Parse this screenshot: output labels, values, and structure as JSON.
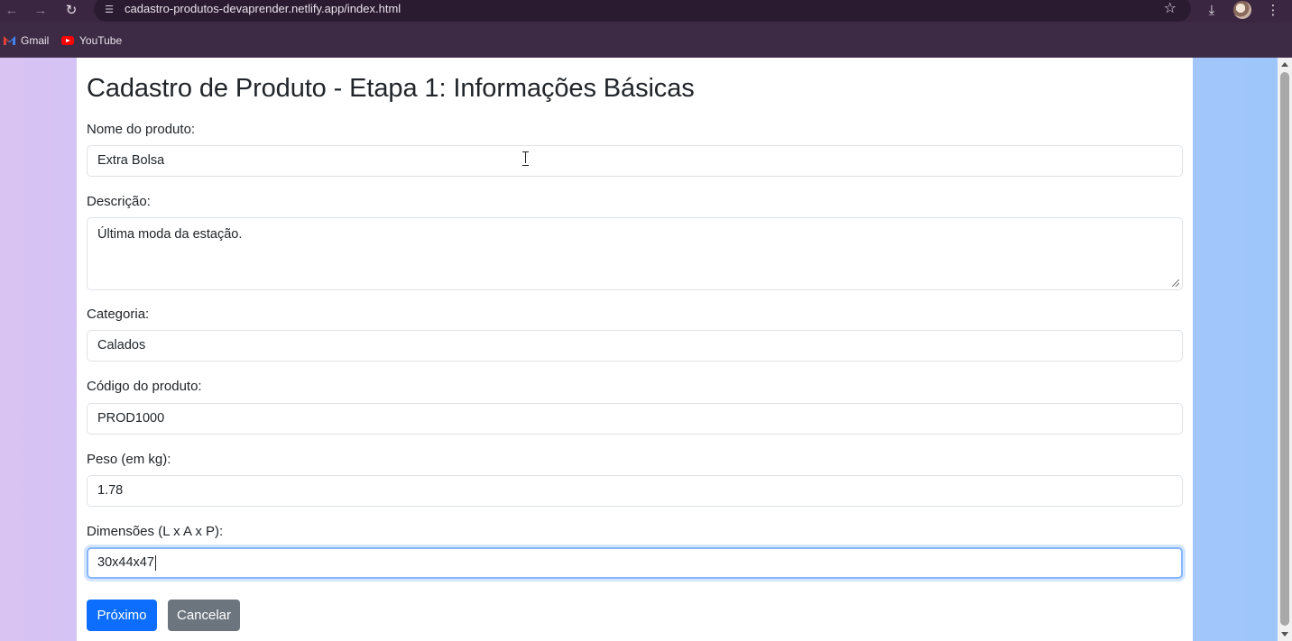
{
  "browser": {
    "url": "cadastro-produtos-devaprender.netlify.app/index.html",
    "icons": {
      "back": "back-arrow-icon",
      "forward": "forward-arrow-icon",
      "reload": "reload-icon",
      "site_info": "tune-icon",
      "bookmark": "star-icon",
      "download": "download-icon",
      "menu": "kebab-menu-icon"
    },
    "bookmarks": [
      {
        "label": "Gmail"
      },
      {
        "label": "YouTube"
      }
    ]
  },
  "page": {
    "title": "Cadastro de Produto - Etapa 1: Informações Básicas",
    "fields": {
      "nome": {
        "label": "Nome do produto:",
        "value": "Extra Bolsa"
      },
      "descricao": {
        "label": "Descrição:",
        "value": "Última moda da estação."
      },
      "categoria": {
        "label": "Categoria:",
        "value": "Calados"
      },
      "codigo": {
        "label": "Código do produto:",
        "value": "PROD1000"
      },
      "peso": {
        "label": "Peso (em kg):",
        "value": "1.78"
      },
      "dimensoes": {
        "label": "Dimensões (L x A x P):",
        "value": "30x44x47"
      }
    },
    "buttons": {
      "next": "Próximo",
      "cancel": "Cancelar"
    }
  },
  "colors": {
    "primary": "#0d6efd",
    "secondary": "#6c757d",
    "focus_ring": "#86b7fe",
    "chrome": "#3b2641"
  }
}
